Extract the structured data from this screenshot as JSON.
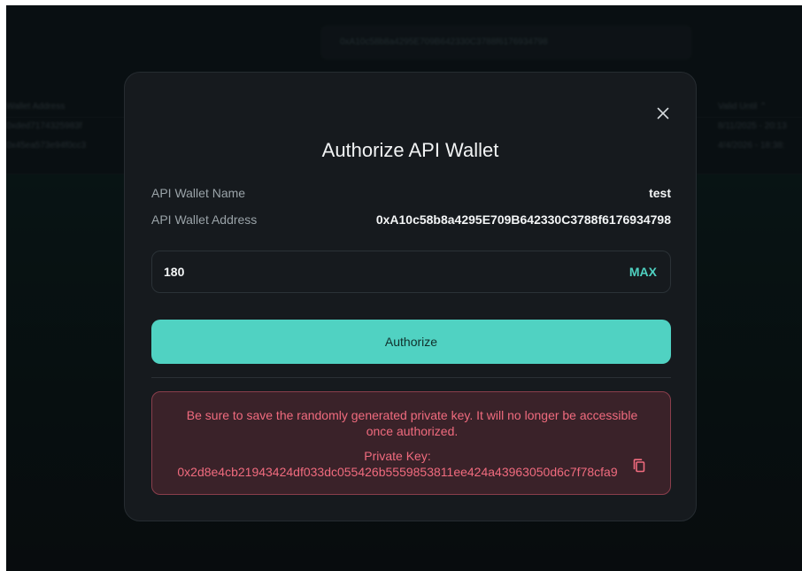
{
  "background": {
    "address_pill": "0xA10c58b8a4295E709B642330C3788f6176934798",
    "left_column": {
      "header": "Wallet Address",
      "rows": [
        "0xded7174325983f",
        "0x45ea573e94f0cc3"
      ]
    },
    "right_column": {
      "header": "Valid Until ⌃",
      "rows": [
        "8/11/2025 - 20:13",
        "4/4/2026 - 18:38:"
      ]
    }
  },
  "modal": {
    "title": "Authorize API Wallet",
    "close_icon": "close-icon",
    "wallet_name_label": "API Wallet Name",
    "wallet_name_value": "test",
    "wallet_address_label": "API Wallet Address",
    "wallet_address_value": "0xA10c58b8a4295E709B642330C3788f6176934798",
    "amount_value": "180",
    "max_label": "MAX",
    "authorize_label": "Authorize",
    "warning_text": "Be sure to save the randomly generated private key. It will no longer be accessible once authorized.",
    "private_key_text": "Private Key: 0x2d8e4cb21943424df033dc055426b5559853811ee424a43963050d6c7f78cfa9",
    "copy_icon": "copy-icon"
  },
  "colors": {
    "accent": "#50d2c2",
    "warning": "#f06b7e",
    "modal_bg": "#161a1e"
  }
}
